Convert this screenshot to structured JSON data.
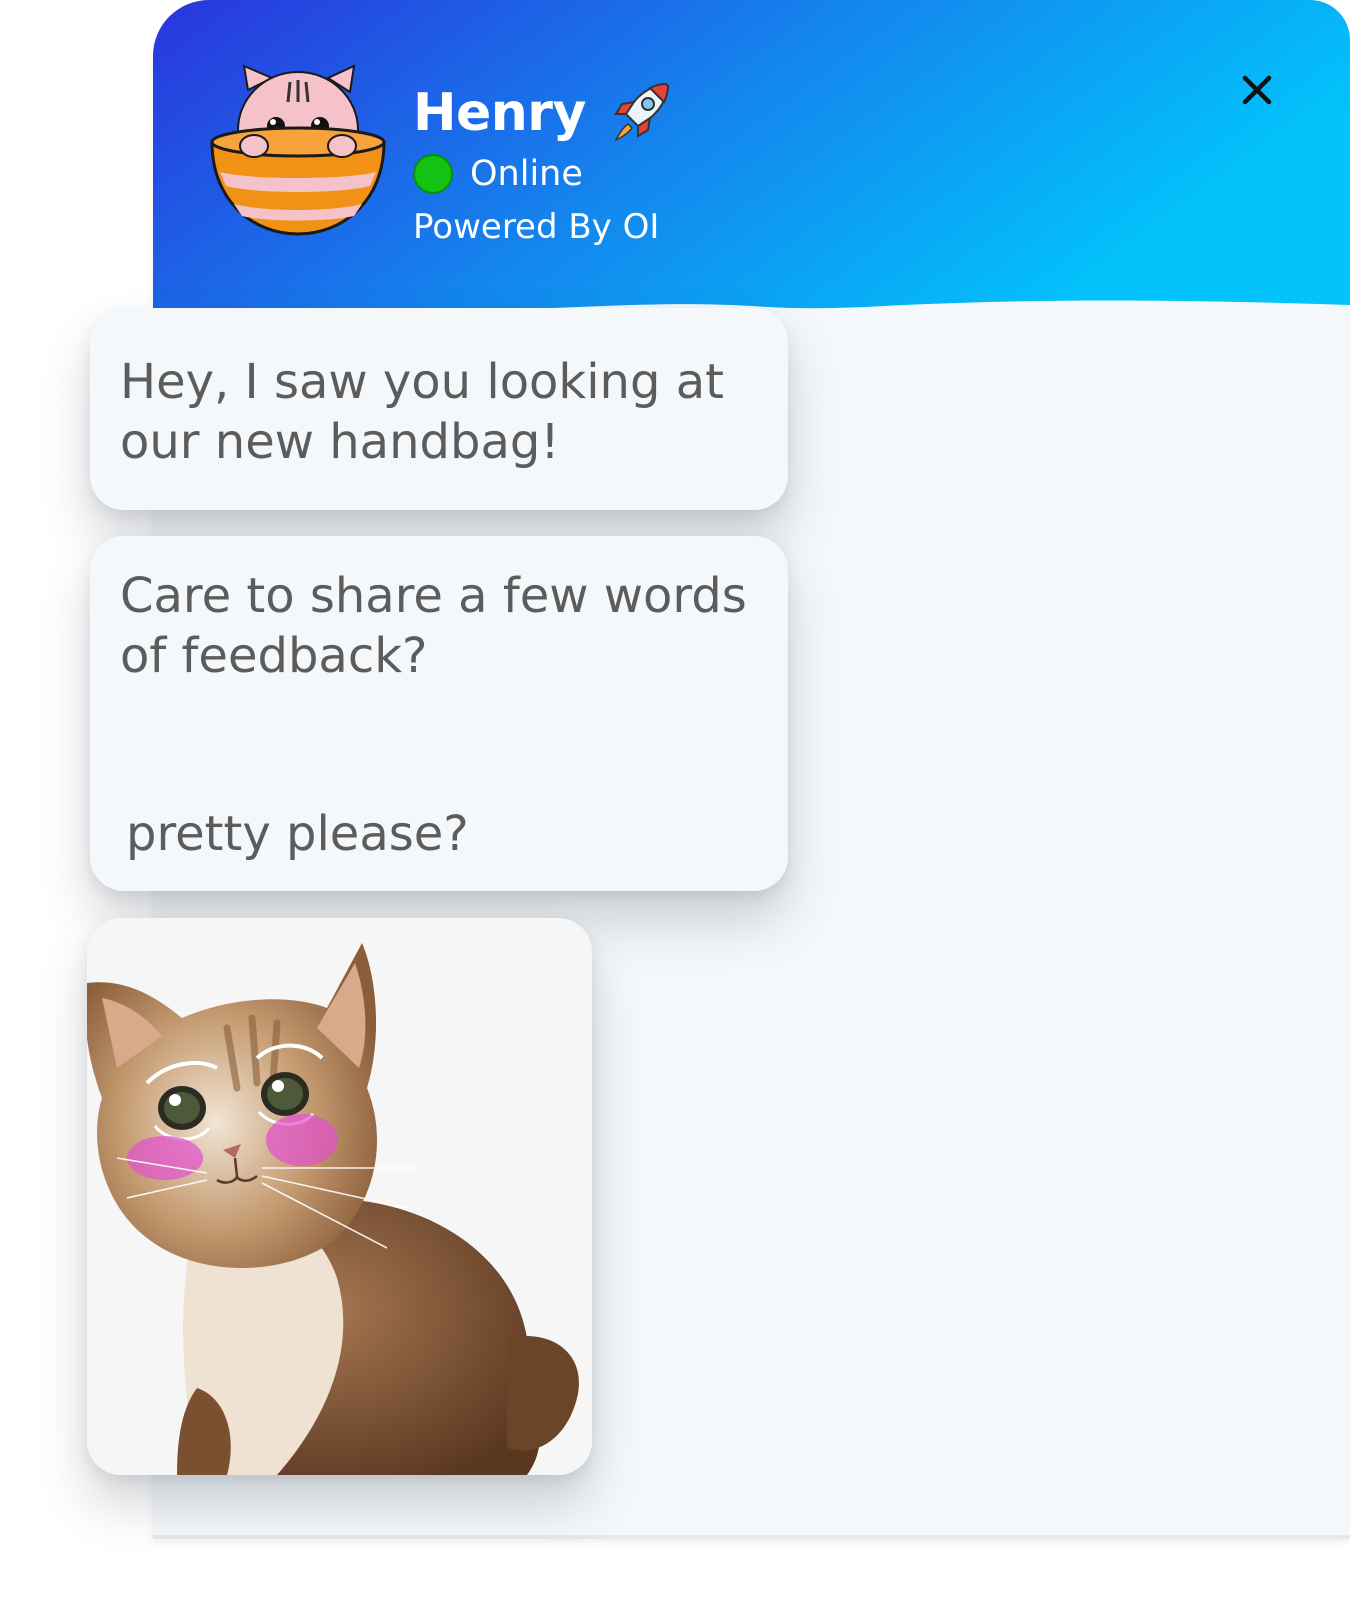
{
  "header": {
    "bot_name": "Henry",
    "status": "Online",
    "powered_by": "Powered By OI",
    "gradient_start": "#2a35dd",
    "gradient_end": "#02c3fb",
    "status_color": "#12c312"
  },
  "icons": {
    "avatar": "cat-in-bowl-avatar",
    "name_badge": "rocket-icon",
    "status": "online-dot-icon",
    "close": "close-icon"
  },
  "messages": [
    {
      "text": "Hey, I saw you looking at our new handbag!"
    },
    {
      "text": "Care to share a few words of feedback?",
      "subtext": "pretty please?"
    }
  ],
  "image_message": {
    "subject": "pleading-cat-image"
  }
}
